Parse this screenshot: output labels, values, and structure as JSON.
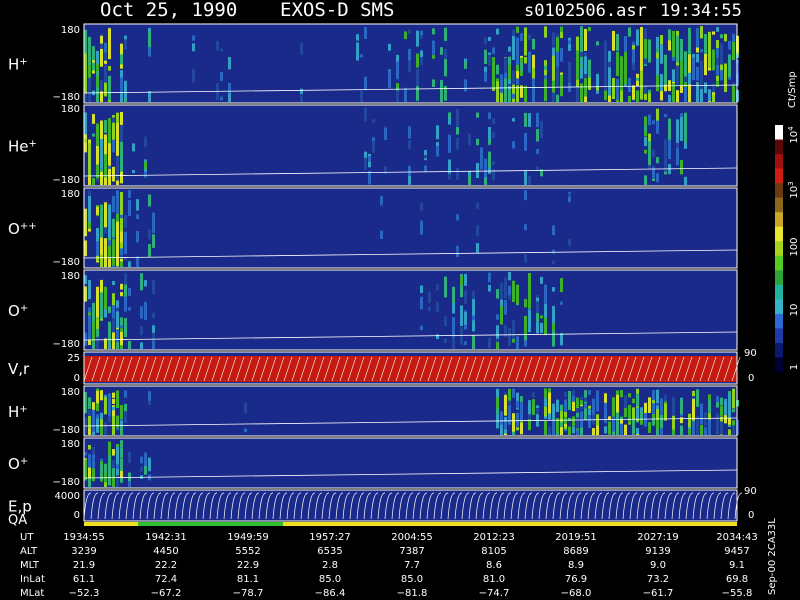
{
  "header": {
    "date": "Oct 25, 1990",
    "instrument": "EXOS-D SMS",
    "file": "s0102506.asr",
    "time": "19:34:55"
  },
  "colorbar": {
    "unit": "Ct/Smp",
    "ticks": [
      "1",
      "10",
      "100",
      "10",
      "10"
    ],
    "tick_exponents": [
      "",
      "",
      "",
      "3",
      "4"
    ],
    "colors": [
      "#000033",
      "#0a1a6e",
      "#1f3aa8",
      "#2e6ad6",
      "#36b3c8",
      "#1fb3a0",
      "#2ea336",
      "#55cc22",
      "#a8d21a",
      "#e6e633",
      "#c8a628",
      "#8a6a1a",
      "#6a3a10",
      "#d01e14",
      "#a01010",
      "#5a0808",
      "#ffffff"
    ]
  },
  "panels": [
    {
      "label": "H",
      "sup": "+",
      "top_tick": "180",
      "bottom_tick": "−180"
    },
    {
      "label": "He",
      "sup": "+",
      "top_tick": "",
      "bottom_tick": "−180"
    },
    {
      "label": "O",
      "sup": "++",
      "top_tick": "180",
      "bottom_tick": "−180"
    },
    {
      "label": "O",
      "sup": "+",
      "top_tick": "180",
      "bottom_tick": "−180"
    },
    {
      "label": "V,r",
      "sup": "",
      "top_tick": "25",
      "bottom_tick": "0",
      "right_top": "90",
      "right_bottom": "0"
    },
    {
      "label": "H",
      "sup": "+",
      "top_tick": "180",
      "bottom_tick": "−180"
    },
    {
      "label": "O",
      "sup": "+",
      "top_tick": "180",
      "bottom_tick": "−180"
    },
    {
      "label": "E,p",
      "sup": "",
      "top_tick": "4000",
      "bottom_tick": "0",
      "right_top": "90",
      "right_bottom": "0"
    }
  ],
  "qa_label": "QA",
  "side_label": "Sep-00  2CA33L",
  "chart_data": {
    "type": "heatmap",
    "title": "Oct 25, 1990   EXOS-D SMS",
    "x_axis_rows": [
      {
        "name": "UT",
        "values": [
          "1934:55",
          "1942:31",
          "1949:59",
          "1957:27",
          "2004:55",
          "2012:23",
          "2019:51",
          "2027:19",
          "2034:43"
        ]
      },
      {
        "name": "ALT",
        "values": [
          "3239",
          "4450",
          "5552",
          "6535",
          "7387",
          "8105",
          "8689",
          "9139",
          "9457"
        ]
      },
      {
        "name": "MLT",
        "values": [
          "21.9",
          "22.2",
          "22.9",
          "2.8",
          "7.7",
          "8.6",
          "8.9",
          "9.0",
          "9.1"
        ]
      },
      {
        "name": "InLat",
        "values": [
          "61.1",
          "72.4",
          "81.1",
          "85.0",
          "85.0",
          "81.0",
          "76.9",
          "73.2",
          "69.8"
        ]
      },
      {
        "name": "MLat",
        "values": [
          "−52.3",
          "−67.2",
          "−78.7",
          "−86.4",
          "−81.8",
          "−74.7",
          "−68.0",
          "−61.7",
          "−55.8"
        ]
      }
    ],
    "color_scale": "log",
    "color_range": [
      1,
      10000
    ]
  }
}
